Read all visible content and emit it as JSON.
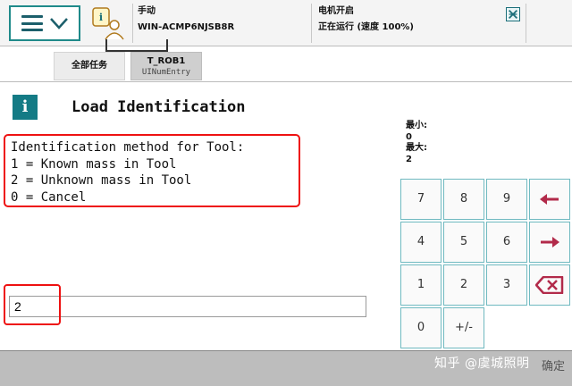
{
  "status": {
    "mode": "手动",
    "controller": "WIN-ACMP6NJSB8R",
    "motor": "电机开启",
    "state": "正在运行 (速度 100%)"
  },
  "tabs": [
    {
      "label": "全部任务",
      "sub": ""
    },
    {
      "label": "T_ROB1",
      "sub": "UINumEntry"
    }
  ],
  "dialog": {
    "title": "Load Identification",
    "lines": [
      "Identification method for Tool:",
      "1 = Known mass in Tool",
      "2 = Unknown mass in Tool",
      "0 = Cancel"
    ]
  },
  "range": {
    "min_label": "最小:",
    "min": "0",
    "max_label": "最大:",
    "max": "2"
  },
  "input": {
    "value": "2"
  },
  "numpad": {
    "keys": [
      "7",
      "8",
      "9",
      "4",
      "5",
      "6",
      "1",
      "2",
      "3",
      "0",
      "+/-"
    ]
  },
  "footer": {
    "confirm": "确定",
    "watermark": "知乎 @虞城照明"
  },
  "colors": {
    "accent": "#147b85",
    "highlight": "#ee1111"
  }
}
